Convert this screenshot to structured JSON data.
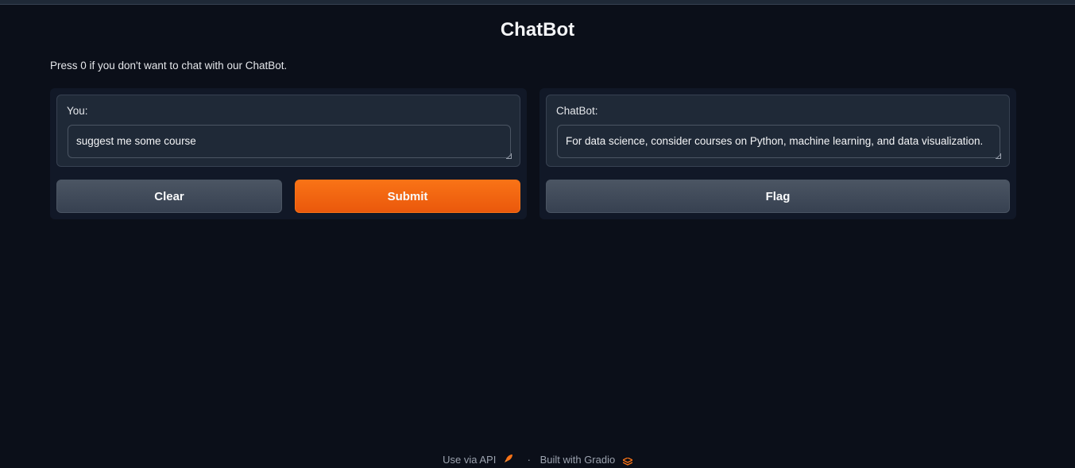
{
  "app": {
    "title": "ChatBot",
    "description": "Press 0 if you don't want to chat with our ChatBot."
  },
  "input_panel": {
    "label": "You:",
    "value": "suggest me some course",
    "clear_label": "Clear",
    "submit_label": "Submit"
  },
  "output_panel": {
    "label": "ChatBot:",
    "value": "For data science, consider courses on Python, machine learning, and data visualization.",
    "flag_label": "Flag"
  },
  "footer": {
    "api_label": "Use via API",
    "separator": "·",
    "built_label": "Built with Gradio",
    "rocket_icon": "rocket-icon",
    "gradio_icon": "gradio-logo-icon"
  },
  "colors": {
    "background": "#0b0f19",
    "primary": "#f97316",
    "secondary": "#4b5563"
  }
}
